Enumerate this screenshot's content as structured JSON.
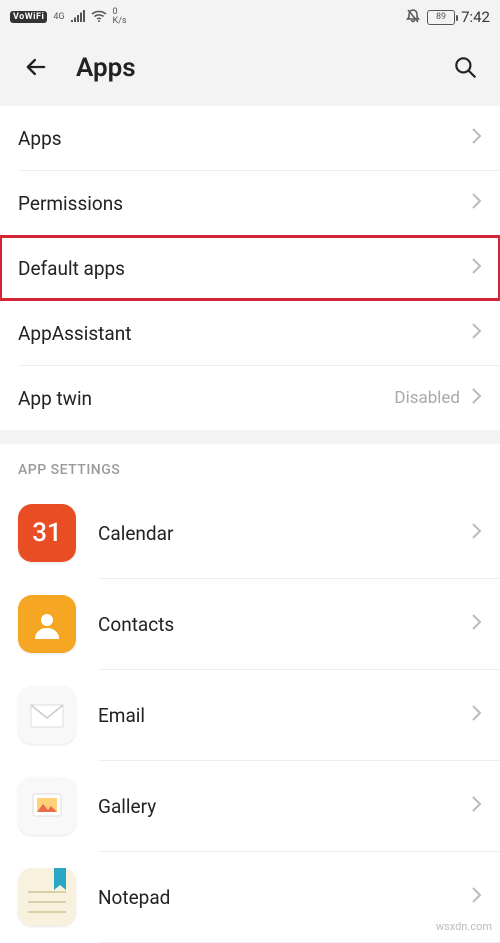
{
  "status": {
    "vowifi": "VoWiFi",
    "net_label": "4G",
    "speed_top": "0",
    "speed_bot": "K/s",
    "battery": "89",
    "time": "7:42"
  },
  "header": {
    "title": "Apps"
  },
  "rows": [
    {
      "label": "Apps",
      "value": "",
      "highlight": false
    },
    {
      "label": "Permissions",
      "value": "",
      "highlight": false
    },
    {
      "label": "Default apps",
      "value": "",
      "highlight": true
    },
    {
      "label": "AppAssistant",
      "value": "",
      "highlight": false
    },
    {
      "label": "App twin",
      "value": "Disabled",
      "highlight": false
    }
  ],
  "section_title": "APP SETTINGS",
  "apps": [
    {
      "label": "Calendar",
      "icon": "calendar",
      "badge": "31"
    },
    {
      "label": "Contacts",
      "icon": "contacts",
      "badge": ""
    },
    {
      "label": "Email",
      "icon": "email",
      "badge": ""
    },
    {
      "label": "Gallery",
      "icon": "gallery",
      "badge": ""
    },
    {
      "label": "Notepad",
      "icon": "notepad",
      "badge": ""
    }
  ],
  "watermark": "wsxdn.com"
}
